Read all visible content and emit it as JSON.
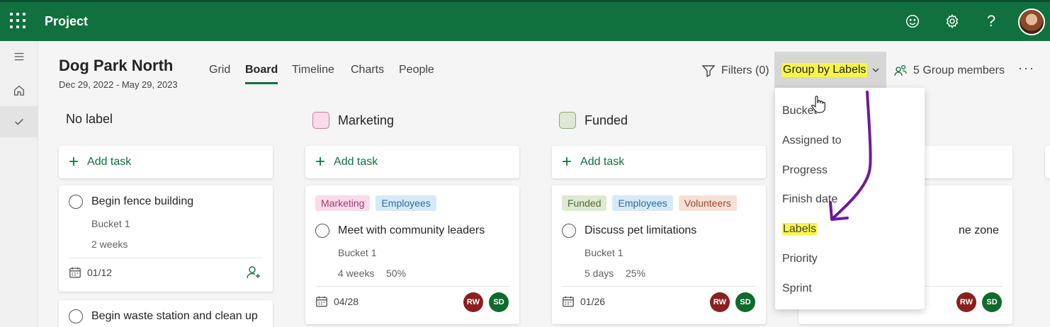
{
  "app": {
    "title": "Project"
  },
  "header_icons": [
    "smiley-icon",
    "gear-icon",
    "help-icon"
  ],
  "plan": {
    "title": "Dog Park North",
    "dates": "Dec 29, 2022 - May 29, 2023"
  },
  "tabs": [
    {
      "label": "Grid"
    },
    {
      "label": "Board"
    },
    {
      "label": "Timeline"
    },
    {
      "label": "Charts"
    },
    {
      "label": "People"
    }
  ],
  "active_tab": "Board",
  "toolbar": {
    "filters_label": "Filters (0)",
    "group_by_label": "Group by Labels",
    "members_label": "5 Group members",
    "more_label": "···"
  },
  "columns": [
    {
      "title": "No label",
      "swatch": null,
      "add_task": "Add task",
      "tasks": [
        {
          "title": "Begin fence building",
          "bucket": "Bucket 1",
          "duration": "2 weeks",
          "due": "01/12"
        },
        {
          "title": "Begin waste station and clean up"
        }
      ]
    },
    {
      "title": "Marketing",
      "swatch": {
        "bg": "#f9dbe9",
        "border": "#c97da3"
      },
      "add_task": "Add task",
      "tasks": [
        {
          "labels": [
            "Marketing",
            "Employees"
          ],
          "title": "Meet with community leaders",
          "bucket": "Bucket 1",
          "duration": "4 weeks",
          "progress": "50%",
          "due": "04/28",
          "assignees": [
            "RW",
            "SD"
          ]
        }
      ]
    },
    {
      "title": "Funded",
      "swatch": {
        "bg": "#dde9d0",
        "border": "#8fa874"
      },
      "add_task": "Add task",
      "tasks": [
        {
          "labels": [
            "Funded",
            "Employees",
            "Volunteers"
          ],
          "title": "Discuss pet limitations",
          "bucket": "Bucket 1",
          "duration": "5 days",
          "progress": "25%",
          "due": "01/26",
          "assignees": [
            "RW",
            "SD"
          ]
        }
      ]
    },
    {
      "partial_title": "ne zone",
      "assignees": [
        "RW",
        "SD"
      ]
    }
  ],
  "group_by_menu": [
    "Bucket",
    "Assigned to",
    "Progress",
    "Finish date",
    "Labels",
    "Priority",
    "Sprint"
  ],
  "colors": {
    "brand": "#10703e",
    "highlight": "#f7f54a",
    "annotation": "#6a1b9a"
  }
}
